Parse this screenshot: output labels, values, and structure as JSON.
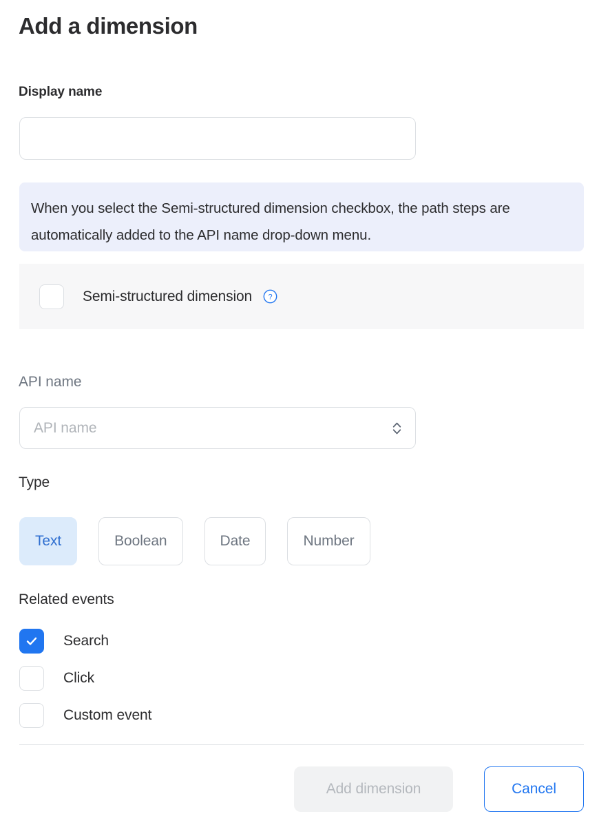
{
  "dialog": {
    "title": "Add a dimension"
  },
  "display_name": {
    "label": "Display name",
    "value": "",
    "placeholder": ""
  },
  "info_banner": {
    "text": "When you select the Semi-structured dimension checkbox, the path steps are automatically added to the API name drop-down menu.",
    "background_color": "#eceffb"
  },
  "semi_structured": {
    "label": "Semi-structured dimension",
    "checked": false,
    "help_icon": "question-circle-icon",
    "help_icon_color": "#2176f0"
  },
  "api_name": {
    "label": "API name",
    "placeholder": "API name",
    "value": "",
    "disabled": true,
    "stepper_icon": "chevron-up-down-icon"
  },
  "type": {
    "label": "Type",
    "selected": "Text",
    "options": [
      {
        "label": "Text",
        "selected": true
      },
      {
        "label": "Boolean",
        "selected": false
      },
      {
        "label": "Date",
        "selected": false
      },
      {
        "label": "Number",
        "selected": false
      }
    ],
    "selected_bg": "#dcebfb",
    "selected_fg": "#2f6fd0"
  },
  "related_events": {
    "label": "Related events",
    "items": [
      {
        "label": "Search",
        "checked": true
      },
      {
        "label": "Click",
        "checked": false
      },
      {
        "label": "Custom event",
        "checked": false
      }
    ],
    "checked_color": "#2176f0"
  },
  "footer": {
    "submit_label": "Add dimension",
    "submit_disabled": true,
    "cancel_label": "Cancel",
    "accent_color": "#2176f0"
  }
}
